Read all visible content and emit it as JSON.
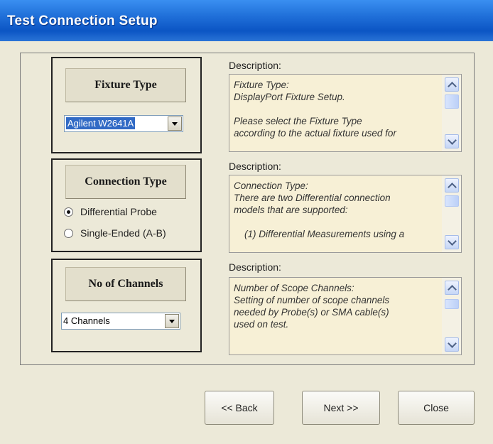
{
  "window": {
    "title": "Test Connection Setup"
  },
  "fixture_group": {
    "header": "Fixture Type",
    "combo_value": "Agilent W2641A"
  },
  "connection_group": {
    "header": "Connection Type",
    "options": [
      {
        "label": "Differential Probe",
        "selected": true
      },
      {
        "label": "Single-Ended (A-B)",
        "selected": false
      }
    ]
  },
  "channels_group": {
    "header": "No of Channels",
    "combo_value": "4 Channels"
  },
  "descriptions": [
    {
      "label": "Description:",
      "text": "Fixture Type:\nDisplayPort Fixture Setup.\n\nPlease select the Fixture Type\naccording to the actual fixture used for"
    },
    {
      "label": "Description:",
      "text": "Connection Type:\nThere are two Differential connection\nmodels that are supported:\n\n    (1) Differential Measurements using a"
    },
    {
      "label": "Description:",
      "text": "Number of Scope Channels:\nSetting of number of scope channels\nneeded by Probe(s) or SMA cable(s)\nused on test."
    }
  ],
  "buttons": {
    "back": "<< Back",
    "next": "Next >>",
    "close": "Close"
  },
  "icons": {
    "scroll_up": "chevron-up-icon",
    "scroll_down": "chevron-down-icon",
    "combo_arrow": "dropdown-arrow-icon"
  },
  "colors": {
    "titlebar": "#0b55c4",
    "window_bg": "#ece9d8",
    "description_bg": "#f7f0d6",
    "selection": "#316ac5"
  }
}
